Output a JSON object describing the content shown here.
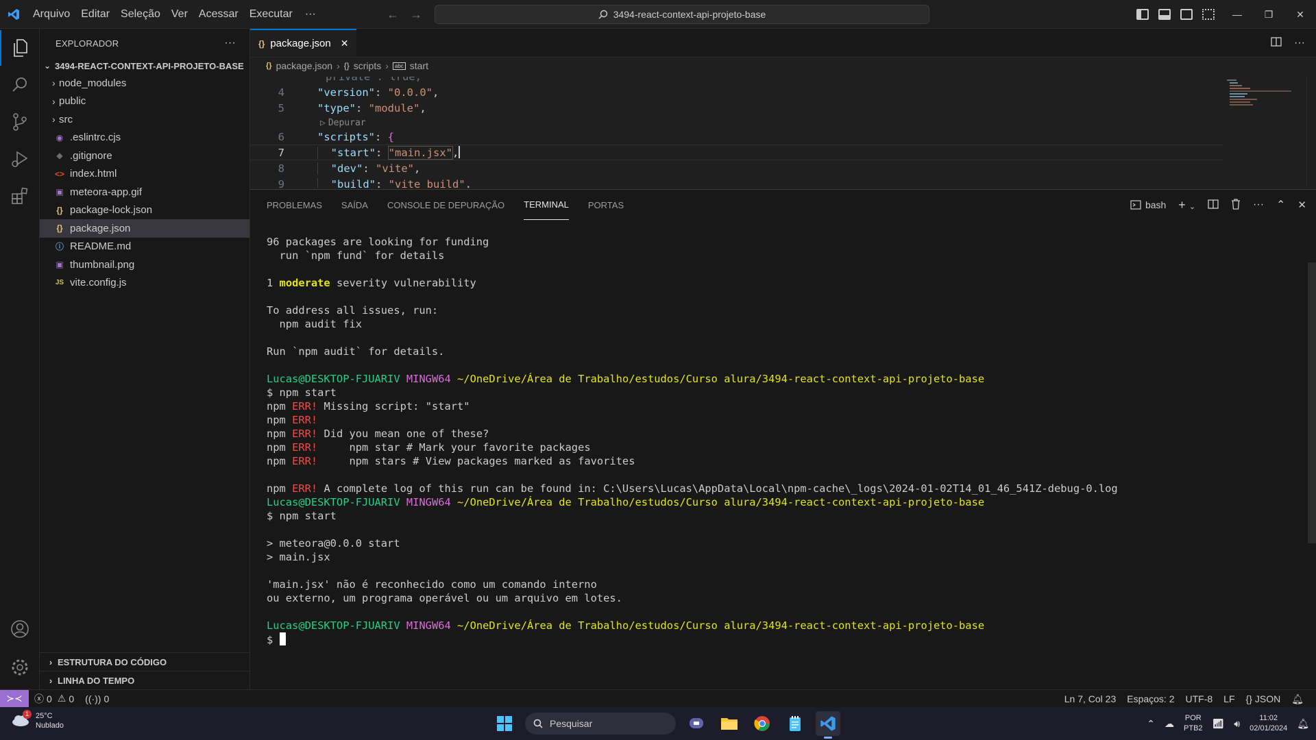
{
  "titlebar": {
    "menu": [
      "Arquivo",
      "Editar",
      "Seleção",
      "Ver",
      "Acessar",
      "Executar"
    ],
    "more": "···",
    "search": "3494-react-context-api-projeto-base"
  },
  "sidebar": {
    "header": "EXPLORADOR",
    "more": "···",
    "project": "3494-REACT-CONTEXT-API-PROJETO-BASE",
    "items": [
      {
        "label": "node_modules",
        "kind": "folder"
      },
      {
        "label": "public",
        "kind": "folder"
      },
      {
        "label": "src",
        "kind": "folder"
      },
      {
        "label": ".eslintrc.cjs",
        "kind": "eslint",
        "icon": "◉",
        "color": "#a074c4"
      },
      {
        "label": ".gitignore",
        "kind": "git",
        "icon": "◆",
        "color": "#6d6d6d"
      },
      {
        "label": "index.html",
        "kind": "html",
        "icon": "<>",
        "color": "#e44d26"
      },
      {
        "label": "meteora-app.gif",
        "kind": "image",
        "icon": "▣",
        "color": "#a074c4"
      },
      {
        "label": "package-lock.json",
        "kind": "json",
        "icon": "{}",
        "color": "#e5c07b"
      },
      {
        "label": "package.json",
        "kind": "json",
        "icon": "{}",
        "color": "#e5c07b"
      },
      {
        "label": "README.md",
        "kind": "info",
        "icon": "ⓘ",
        "color": "#519aba"
      },
      {
        "label": "thumbnail.png",
        "kind": "image",
        "icon": "▣",
        "color": "#a074c4"
      },
      {
        "label": "vite.config.js",
        "kind": "js",
        "icon": "JS",
        "color": "#cbcb41"
      }
    ],
    "sections": [
      "ESTRUTURA DO CÓDIGO",
      "LINHA DO TEMPO"
    ]
  },
  "editor": {
    "tab": "package.json",
    "breadcrumb": [
      "package.json",
      "scripts",
      "start"
    ],
    "codelens": "Depurar",
    "lines": [
      {
        "n": "4",
        "key": "\"version\"",
        "val": "\"0.0.0\"",
        "end": ","
      },
      {
        "n": "5",
        "key": "\"type\"",
        "val": "\"module\"",
        "end": ","
      },
      {
        "n": "6",
        "key": "\"scripts\"",
        "val": "{",
        "end": ""
      },
      {
        "n": "7",
        "key": "\"start\"",
        "val": "\"main.jsx\"",
        "end": ","
      },
      {
        "n": "8",
        "key": "\"dev\"",
        "val": "\"vite\"",
        "end": ","
      },
      {
        "n": "9",
        "key": "\"build\"",
        "val": "\"vite build\"",
        "end": ","
      }
    ]
  },
  "panel": {
    "tabs": [
      "PROBLEMAS",
      "SAÍDA",
      "CONSOLE DE DEPURAÇÃO",
      "TERMINAL",
      "PORTAS"
    ],
    "active_tab": "TERMINAL",
    "shell": "bash",
    "terminal": {
      "l1": "96 packages are looking for funding",
      "l2": "  run `npm fund` for details",
      "l3a": "1 ",
      "l3b": "moderate",
      "l3c": " severity vulnerability",
      "l4": "To address all issues, run:",
      "l5": "  npm audit fix",
      "l6": "Run `npm audit` for details.",
      "user": "Lucas@DESKTOP-FJUARIV",
      "env": "MINGW64",
      "path": "~/OneDrive/Área de Trabalho/estudos/Curso alura/3494-react-context-api-projeto-base",
      "cmd": "$ npm start",
      "npm": "npm",
      "err": "ERR!",
      "e1": " Missing script: \"start\"",
      "e3": " Did you mean one of these?",
      "e4": "     npm star # Mark your favorite packages",
      "e5": "     npm stars # View packages marked as favorites",
      "e6": " A complete log of this run can be found in: C:\\Users\\Lucas\\AppData\\Local\\npm-cache\\_logs\\2024-01-02T14_01_46_541Z-debug-0.log",
      "r1": "> meteora@0.0.0 start",
      "r2": "> main.jsx",
      "m1": "'main.jsx' não é reconhecido como um comando interno",
      "m2": "ou externo, um programa operável ou um arquivo em lotes.",
      "prompt": "$ "
    }
  },
  "statusbar": {
    "errors": "0",
    "warnings": "0",
    "ports": "0",
    "position": "Ln 7, Col 23",
    "spaces": "Espaços: 2",
    "encoding": "UTF-8",
    "eol": "LF",
    "language": "JSON"
  },
  "taskbar": {
    "temp": "25°C",
    "weather": "Nublado",
    "badge": "1",
    "search": "Pesquisar",
    "lang1": "POR",
    "lang2": "PTB2",
    "time": "11:02",
    "date": "02/01/2024"
  },
  "colors": {
    "accent": "#0078d4",
    "remote": "#9b6fd2",
    "prompt_user": "#23d18b",
    "prompt_env": "#d670d6",
    "prompt_path": "#e5e510",
    "error": "#f14c4c"
  }
}
